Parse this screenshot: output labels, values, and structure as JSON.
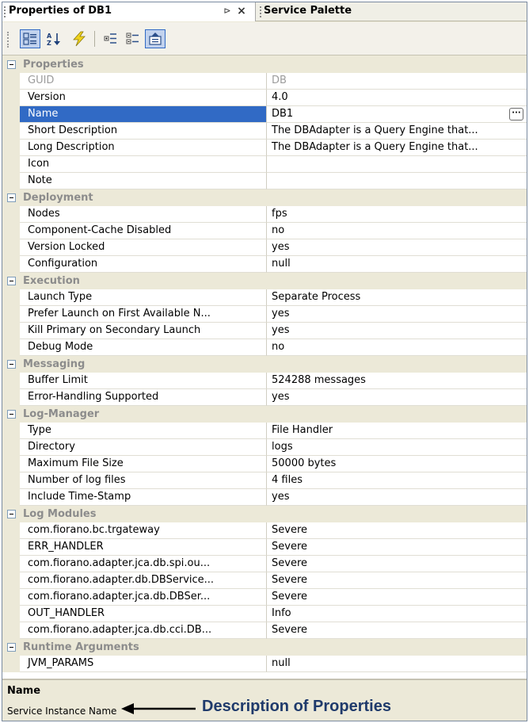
{
  "window": {
    "active_tab": "Properties of DB1",
    "other_tab": "Service Palette",
    "pin_glyph": "⊳",
    "close_glyph": "×"
  },
  "toolbar": {
    "buttons": [
      {
        "icon": "categorized-icon",
        "pressed": true
      },
      {
        "icon": "sort-alpha-icon",
        "pressed": false
      },
      {
        "icon": "events-icon",
        "pressed": false
      },
      {
        "icon": "expand-icon",
        "pressed": false
      },
      {
        "icon": "collapse-icon",
        "pressed": false
      },
      {
        "icon": "property-pages-icon",
        "pressed": true
      }
    ]
  },
  "grid": {
    "ellipsis": "···",
    "rows": [
      {
        "type": "category",
        "label": "Properties"
      },
      {
        "type": "prop",
        "name": "GUID",
        "value": "DB",
        "disabled": true
      },
      {
        "type": "prop",
        "name": "Version",
        "value": "4.0"
      },
      {
        "type": "prop",
        "name": "Name",
        "value": "DB1",
        "selected": true,
        "ellipsis": true
      },
      {
        "type": "prop",
        "name": "Short Description",
        "value": "The DBAdapter is a Query Engine that..."
      },
      {
        "type": "prop",
        "name": "Long Description",
        "value": "The DBAdapter is a Query Engine that..."
      },
      {
        "type": "prop",
        "name": "Icon",
        "value": ""
      },
      {
        "type": "prop",
        "name": "Note",
        "value": ""
      },
      {
        "type": "category",
        "label": "Deployment"
      },
      {
        "type": "prop",
        "name": "Nodes",
        "value": "fps"
      },
      {
        "type": "prop",
        "name": "Component-Cache Disabled",
        "value": "no"
      },
      {
        "type": "prop",
        "name": "Version Locked",
        "value": "yes"
      },
      {
        "type": "prop",
        "name": "Configuration",
        "value": "null"
      },
      {
        "type": "category",
        "label": "Execution"
      },
      {
        "type": "prop",
        "name": "Launch Type",
        "value": "Separate Process"
      },
      {
        "type": "prop",
        "name": "Prefer Launch on First Available N...",
        "value": "yes"
      },
      {
        "type": "prop",
        "name": "Kill Primary on Secondary Launch",
        "value": "yes"
      },
      {
        "type": "prop",
        "name": "Debug Mode",
        "value": "no"
      },
      {
        "type": "category",
        "label": "Messaging"
      },
      {
        "type": "prop",
        "name": "Buffer Limit",
        "value": "524288 messages"
      },
      {
        "type": "prop",
        "name": "Error-Handling Supported",
        "value": "yes"
      },
      {
        "type": "category",
        "label": "Log-Manager"
      },
      {
        "type": "prop",
        "name": "Type",
        "value": "File Handler"
      },
      {
        "type": "prop",
        "name": "Directory",
        "value": "logs"
      },
      {
        "type": "prop",
        "name": "Maximum File Size",
        "value": "50000 bytes"
      },
      {
        "type": "prop",
        "name": "Number of log files",
        "value": "4 files"
      },
      {
        "type": "prop",
        "name": "Include Time-Stamp",
        "value": "yes"
      },
      {
        "type": "category",
        "label": "Log Modules"
      },
      {
        "type": "prop",
        "name": "com.fiorano.bc.trgateway",
        "value": "Severe"
      },
      {
        "type": "prop",
        "name": "ERR_HANDLER",
        "value": "Severe"
      },
      {
        "type": "prop",
        "name": "com.fiorano.adapter.jca.db.spi.ou...",
        "value": "Severe"
      },
      {
        "type": "prop",
        "name": "com.fiorano.adapter.db.DBService...",
        "value": "Severe"
      },
      {
        "type": "prop",
        "name": "com.fiorano.adapter.jca.db.DBSer...",
        "value": "Severe"
      },
      {
        "type": "prop",
        "name": "OUT_HANDLER",
        "value": "Info"
      },
      {
        "type": "prop",
        "name": "com.fiorano.adapter.jca.db.cci.DB...",
        "value": "Severe"
      },
      {
        "type": "category",
        "label": "Runtime Arguments"
      },
      {
        "type": "prop",
        "name": "JVM_PARAMS",
        "value": "null"
      }
    ]
  },
  "description": {
    "title": "Name",
    "text": "Service Instance Name",
    "callout": "Description of Properties"
  },
  "colors": {
    "selection": "#316ac5",
    "category_bg": "#ece9d8",
    "category_text": "#8c8c8c",
    "callout_text": "#1f3a6b"
  }
}
